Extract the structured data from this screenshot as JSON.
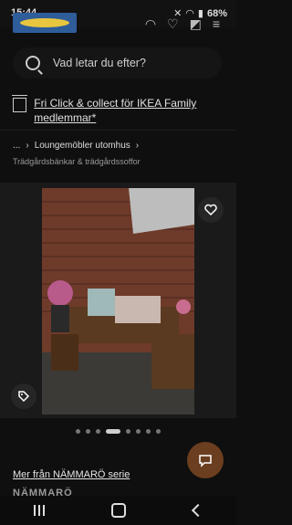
{
  "status": {
    "time": "15:44",
    "battery": "68%"
  },
  "search": {
    "placeholder": "Vad letar du efter?"
  },
  "promo": {
    "text": "Fri Click & collect för IKEA Family medlemmar*"
  },
  "breadcrumb": {
    "ellipsis": "...",
    "current": "Loungemöbler utomhus",
    "sub": "Trädgårdsbänkar & trädgårdssoffor"
  },
  "gallery": {
    "dot_count": 8,
    "active_index": 3
  },
  "links": {
    "more_series": "Mer från NÄMMARÖ serie",
    "cut_heading": "NÄMMARÖ"
  },
  "icons": {
    "favorite": "heart-icon",
    "tag": "tag-icon",
    "chat": "chat-icon"
  }
}
